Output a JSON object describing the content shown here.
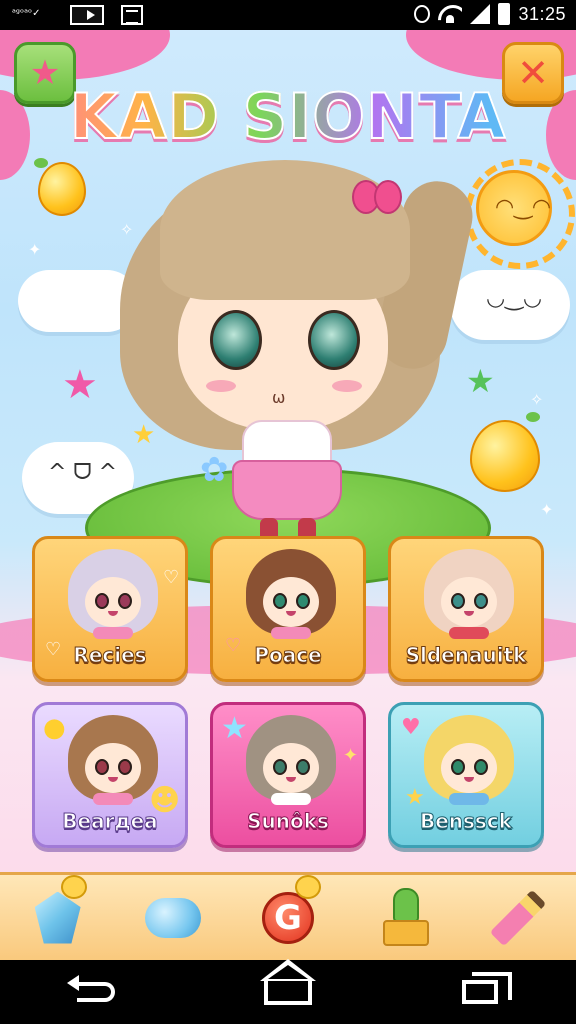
{
  "status_bar": {
    "left_text": "ᵃᵍᵒᵃᵒ✓",
    "time": "31:25",
    "icons": [
      "media-icon",
      "grid-icon",
      "alarm-icon",
      "wifi-icon",
      "signal-icon",
      "battery-icon"
    ]
  },
  "header": {
    "title": "KAD SIONTA",
    "left_button_icon": "star-icon",
    "right_button_icon": "close-icon",
    "accent_colors": [
      "#ff6fa8",
      "#ffb347",
      "#7cd65a",
      "#b274f0",
      "#5fb9f5"
    ]
  },
  "characters": [
    {
      "label": "Recies",
      "style": "orange",
      "hair": "#d9d0e6"
    },
    {
      "label": "Poace",
      "style": "orange",
      "hair": "#8a5133"
    },
    {
      "label": "Sldenauitk",
      "style": "orange",
      "hair": "#f0d3c2"
    },
    {
      "label": "Bearдea",
      "style": "lavender",
      "hair": "#a8774e"
    },
    {
      "label": "Sunôks",
      "style": "pink",
      "hair": "#a09282"
    },
    {
      "label": "Benssck",
      "style": "teal",
      "hair": "#f4d668"
    }
  ],
  "toolbar": {
    "items": [
      {
        "icon": "crystal-icon"
      },
      {
        "icon": "balloon-dog-icon"
      },
      {
        "icon": "g-badge-icon",
        "text": "G"
      },
      {
        "icon": "stamp-icon"
      },
      {
        "icon": "pencil-icon"
      }
    ]
  },
  "navbar": {
    "items": [
      "back-icon",
      "home-icon",
      "recent-apps-icon"
    ]
  }
}
